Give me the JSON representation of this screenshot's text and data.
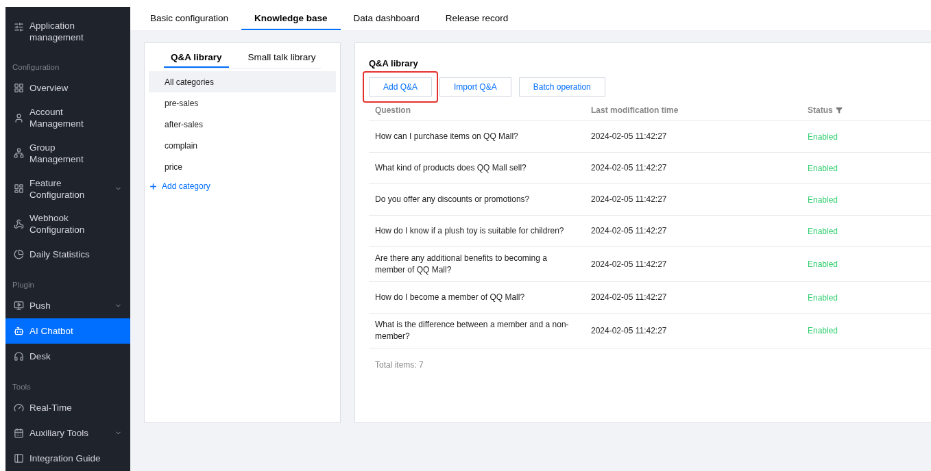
{
  "sidebar": {
    "items": [
      {
        "kind": "item",
        "label": "Application management",
        "expandable": false,
        "selected": false
      },
      {
        "kind": "section",
        "label": "Configuration"
      },
      {
        "kind": "item",
        "label": "Overview",
        "expandable": false,
        "selected": false
      },
      {
        "kind": "item",
        "label": "Account Management",
        "expandable": false,
        "selected": false
      },
      {
        "kind": "item",
        "label": "Group Management",
        "expandable": false,
        "selected": false
      },
      {
        "kind": "item",
        "label": "Feature Configuration",
        "expandable": true,
        "selected": false
      },
      {
        "kind": "item",
        "label": "Webhook Configuration",
        "expandable": false,
        "selected": false
      },
      {
        "kind": "item",
        "label": "Daily Statistics",
        "expandable": false,
        "selected": false
      },
      {
        "kind": "section",
        "label": "Plugin"
      },
      {
        "kind": "item",
        "label": "Push",
        "expandable": true,
        "selected": false
      },
      {
        "kind": "item",
        "label": "AI Chatbot",
        "expandable": false,
        "selected": true
      },
      {
        "kind": "item",
        "label": "Desk",
        "expandable": false,
        "selected": false
      },
      {
        "kind": "section",
        "label": "Tools"
      },
      {
        "kind": "item",
        "label": "Real-Time",
        "expandable": false,
        "selected": false
      },
      {
        "kind": "item",
        "label": "Auxiliary Tools",
        "expandable": true,
        "selected": false
      },
      {
        "kind": "item",
        "label": "Integration Guide",
        "expandable": false,
        "selected": false
      }
    ]
  },
  "tabs": [
    {
      "label": "Basic configuration",
      "selected": false
    },
    {
      "label": "Knowledge base",
      "selected": true
    },
    {
      "label": "Data dashboard",
      "selected": false
    },
    {
      "label": "Release record",
      "selected": false
    }
  ],
  "library_tabs": [
    {
      "label": "Q&A library",
      "selected": true
    },
    {
      "label": "Small talk library",
      "selected": false
    }
  ],
  "categories": [
    {
      "label": "All categories",
      "selected": true
    },
    {
      "label": "pre-sales",
      "selected": false
    },
    {
      "label": "after-sales",
      "selected": false
    },
    {
      "label": "complain",
      "selected": false
    },
    {
      "label": "price",
      "selected": false
    }
  ],
  "add_category": "Add category",
  "panel": {
    "title": "Q&A library",
    "buttons": [
      {
        "label": "Add Q&A",
        "highlighted": true
      },
      {
        "label": "Import Q&A",
        "highlighted": false
      },
      {
        "label": "Batch operation",
        "highlighted": false
      }
    ],
    "table": {
      "columns": [
        {
          "label": "Question",
          "filter": false
        },
        {
          "label": "Last modification time",
          "filter": false
        },
        {
          "label": "Status",
          "filter": true
        }
      ],
      "rows": [
        {
          "question": "How can I purchase items on QQ Mall?",
          "time": "2024-02-05 11:42:27",
          "status": "Enabled"
        },
        {
          "question": "What kind of products does QQ Mall sell?",
          "time": "2024-02-05 11:42:27",
          "status": "Enabled"
        },
        {
          "question": "Do you offer any discounts or promotions?",
          "time": "2024-02-05 11:42:27",
          "status": "Enabled"
        },
        {
          "question": "How do I know if a plush toy is suitable for children?",
          "time": "2024-02-05 11:42:27",
          "status": "Enabled"
        },
        {
          "question": "Are there any additional benefits to becoming a member of QQ Mall?",
          "time": "2024-02-05 11:42:27",
          "status": "Enabled"
        },
        {
          "question": "How do I become a member of QQ Mall?",
          "time": "2024-02-05 11:42:27",
          "status": "Enabled"
        },
        {
          "question": "What is the difference between a member and a non-member?",
          "time": "2024-02-05 11:42:27",
          "status": "Enabled"
        }
      ]
    },
    "total": "Total items:  7"
  }
}
